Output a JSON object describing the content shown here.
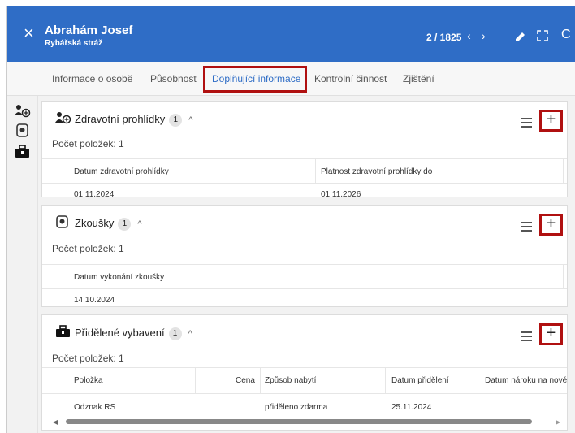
{
  "header": {
    "close_glyph": "×",
    "name": "Abrahám Josef",
    "subtitle": "Rybářská stráž",
    "pager": "2 / 1825",
    "prev_glyph": "‹",
    "next_glyph": "›",
    "expand_glyph": "⛶",
    "refresh_glyph": "C",
    "color": "#2f6dc6"
  },
  "tabs": [
    {
      "label": "Informace o osobě",
      "active": false
    },
    {
      "label": "Působnost",
      "active": false
    },
    {
      "label": "Doplňující informace",
      "active": true
    },
    {
      "label": "Kontrolní činnost",
      "active": false
    },
    {
      "label": "Zjištění",
      "active": false
    }
  ],
  "rail": [
    "medical-person-icon",
    "test-badge-icon",
    "toolbox-icon"
  ],
  "sections": {
    "health": {
      "title": "Zdravotní prohlídky",
      "badge": "1",
      "caret": "^",
      "count": "Počet položek: 1",
      "add": "+",
      "icon": "medical-person-icon",
      "columns": [
        "Datum zdravotní prohlídky",
        "Platnost zdravotní prohlídky do"
      ],
      "rows": [
        [
          "01.11.2024",
          "01.11.2026"
        ]
      ]
    },
    "exams": {
      "title": "Zkoušky",
      "badge": "1",
      "caret": "^",
      "count": "Počet položek: 1",
      "add": "+",
      "icon": "test-badge-icon",
      "columns": [
        "Datum vykonání zkoušky"
      ],
      "rows": [
        [
          "14.10.2024"
        ]
      ]
    },
    "equipment": {
      "title": "Přidělené vybavení",
      "badge": "1",
      "caret": "^",
      "count": "Počet položek: 1",
      "add": "+",
      "icon": "toolbox-icon",
      "columns": [
        "Položka",
        "Cena",
        "Způsob nabytí",
        "Datum přidělení",
        "Datum nároku na nové"
      ],
      "rows": [
        [
          "Odznak RS",
          "",
          "přiděleno zdarma",
          "25.11.2024",
          ""
        ]
      ]
    }
  },
  "scrollbar": {
    "left_glyph": "◀",
    "right_glyph": "▶"
  },
  "accent_red": "#b01010"
}
